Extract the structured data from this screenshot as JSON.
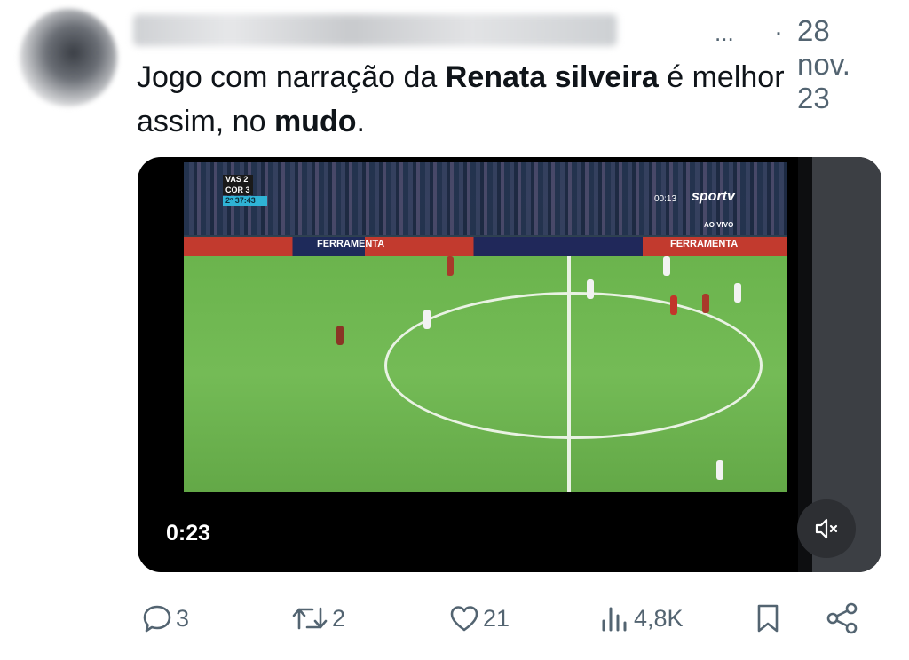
{
  "tweet": {
    "date_separator": "·",
    "date": "28 nov. 23",
    "name_ellipsis": "...",
    "text_parts": {
      "p1": "Jogo com narração da ",
      "p2": "Renata silveira",
      "p3": " é melhor assim, no ",
      "p4": "mudo",
      "p5": "."
    }
  },
  "video": {
    "timestamp": "0:23",
    "scoreboard": {
      "team1": "VAS",
      "team1_score": "2",
      "team2": "COR",
      "team2_score": "3",
      "time": "2º 37:43"
    },
    "broadcaster": "sportv",
    "clock": "00:13",
    "live_label": "AO VIVO",
    "board_left": "FERRAMENTA",
    "board_right": "FERRAMENTA"
  },
  "actions": {
    "replies": "3",
    "retweets": "2",
    "likes": "21",
    "views": "4,8K"
  },
  "colors": {
    "text": "#0f1419",
    "secondary": "#536471"
  }
}
